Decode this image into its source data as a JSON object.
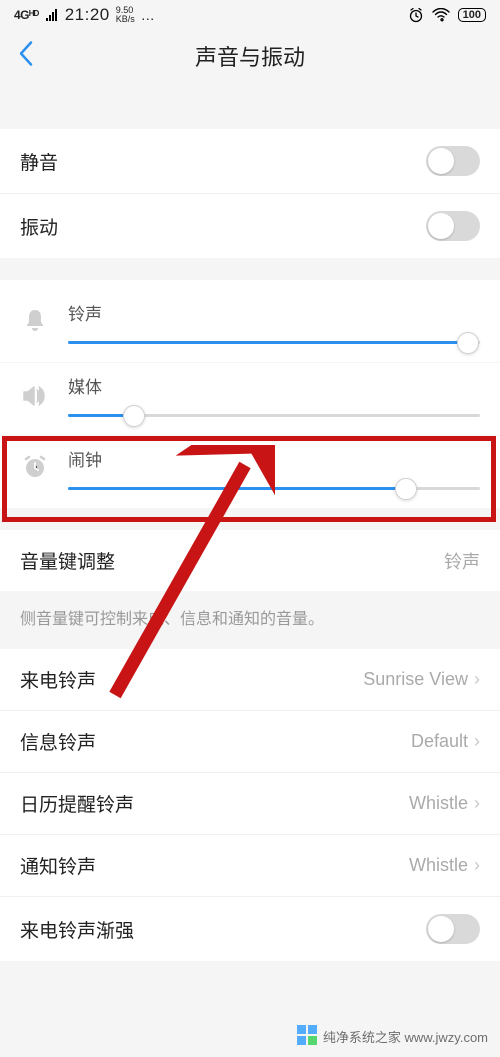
{
  "status": {
    "signal": "4Gᴴᴰ",
    "time": "21:20",
    "kbs_top": "9.50",
    "kbs_bot": "KB/s",
    "dots": "…",
    "battery": "100"
  },
  "nav": {
    "title": "声音与振动"
  },
  "toggles": {
    "mute": "静音",
    "vibrate": "振动"
  },
  "sliders": {
    "ring": {
      "label": "铃声",
      "pct": 97
    },
    "media": {
      "label": "媒体",
      "pct": 16
    },
    "alarm": {
      "label": "闹钟",
      "pct": 82
    }
  },
  "volkey": {
    "label": "音量键调整",
    "value": "铃声",
    "hint": "侧音量键可控制来电、信息和通知的音量。"
  },
  "ringtones": {
    "call": {
      "label": "来电铃声",
      "value": "Sunrise View"
    },
    "msg": {
      "label": "信息铃声",
      "value": "Default"
    },
    "cal": {
      "label": "日历提醒铃声",
      "value": "Whistle"
    },
    "notif": {
      "label": "通知铃声",
      "value": "Whistle"
    },
    "ascend": {
      "label": "来电铃声渐强"
    }
  },
  "watermark": "纯净系统之家 www.jwzy.com"
}
